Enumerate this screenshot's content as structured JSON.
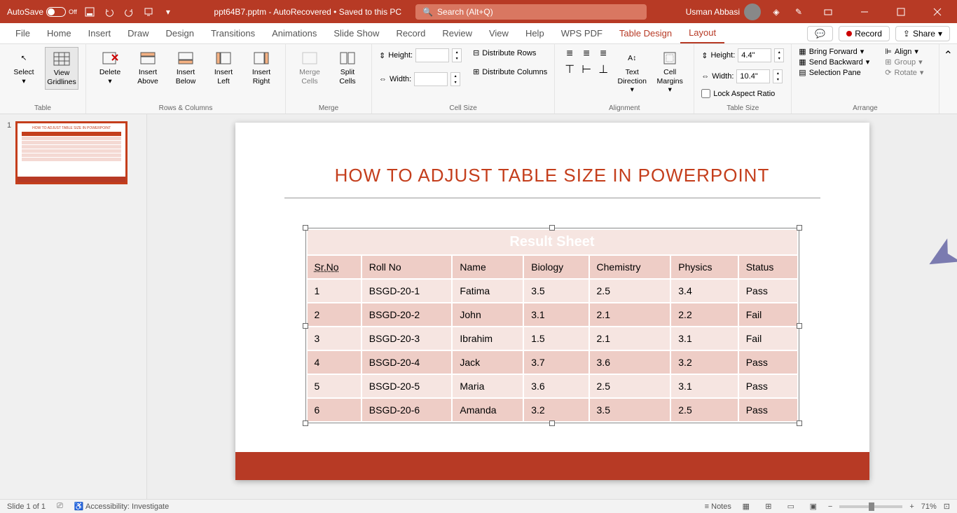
{
  "titlebar": {
    "autosave_label": "AutoSave",
    "autosave_state": "Off",
    "doc_name": "ppt64B7.pptm - AutoRecovered • Saved to this PC",
    "search_placeholder": "Search (Alt+Q)",
    "user_name": "Usman Abbasi"
  },
  "tabs": {
    "items": [
      "File",
      "Home",
      "Insert",
      "Draw",
      "Design",
      "Transitions",
      "Animations",
      "Slide Show",
      "Record",
      "Review",
      "View",
      "Help",
      "WPS PDF",
      "Table Design",
      "Layout"
    ],
    "active": "Layout",
    "comments_icon": "comments",
    "record_label": "Record",
    "share_label": "Share"
  },
  "ribbon": {
    "table": {
      "select": "Select",
      "gridlines": "View Gridlines",
      "label": "Table"
    },
    "rows_cols": {
      "delete": "Delete",
      "above": "Insert Above",
      "below": "Insert Below",
      "left": "Insert Left",
      "right": "Insert Right",
      "label": "Rows & Columns"
    },
    "merge": {
      "merge": "Merge Cells",
      "split": "Split Cells",
      "label": "Merge"
    },
    "cellsize": {
      "height": "Height:",
      "width": "Width:",
      "distrows": "Distribute Rows",
      "distcols": "Distribute Columns",
      "label": "Cell Size"
    },
    "alignment": {
      "textdir": "Text Direction",
      "margins": "Cell Margins",
      "label": "Alignment"
    },
    "tablesize": {
      "height": "Height:",
      "width": "Width:",
      "hval": "4.4\"",
      "wval": "10.4\"",
      "lock": "Lock Aspect Ratio",
      "label": "Table Size"
    },
    "arrange": {
      "forward": "Bring Forward",
      "backward": "Send Backward",
      "pane": "Selection Pane",
      "align": "Align",
      "group": "Group",
      "rotate": "Rotate",
      "label": "Arrange"
    }
  },
  "thumb": {
    "num": "1"
  },
  "slide": {
    "title": "HOW TO ADJUST TABLE SIZE IN POWERPOINT",
    "table_title": "Result  Sheet",
    "columns": [
      "Sr.No",
      "Roll No",
      "Name",
      "Biology",
      "Chemistry",
      "Physics",
      "Status"
    ],
    "rows": [
      [
        "1",
        "BSGD-20-1",
        "Fatima",
        "3.5",
        "2.5",
        "3.4",
        "Pass"
      ],
      [
        "2",
        "BSGD-20-2",
        "John",
        "3.1",
        "2.1",
        "2.2",
        "Fail"
      ],
      [
        "3",
        "BSGD-20-3",
        "Ibrahim",
        "1.5",
        "2.1",
        "3.1",
        "Fail"
      ],
      [
        "4",
        "BSGD-20-4",
        "Jack",
        "3.7",
        "3.6",
        "3.2",
        "Pass"
      ],
      [
        "5",
        "BSGD-20-5",
        "Maria",
        "3.6",
        "2.5",
        "3.1",
        "Pass"
      ],
      [
        "6",
        "BSGD-20-6",
        "Amanda",
        "3.2",
        "3.5",
        "2.5",
        "Pass"
      ]
    ]
  },
  "statusbar": {
    "slide_info": "Slide 1 of 1",
    "accessibility": "Accessibility: Investigate",
    "notes": "Notes",
    "zoom": "71%"
  }
}
